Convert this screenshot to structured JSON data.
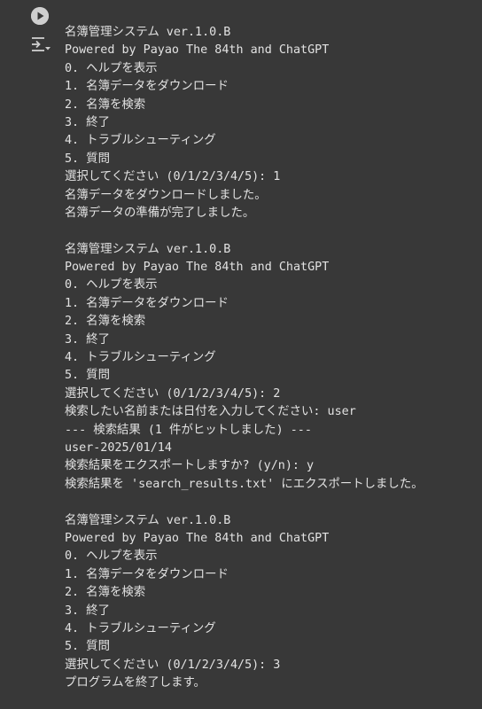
{
  "cell": {
    "run_icon": "play-circle-icon",
    "output_icon": "output-toggle-icon",
    "output_lines": [
      "名簿管理システム ver.1.0.B",
      "Powered by Payao The 84th and ChatGPT",
      "0. ヘルプを表示",
      "1. 名簿データをダウンロード",
      "2. 名簿を検索",
      "3. 終了",
      "4. トラブルシューティング",
      "5. 質問",
      "選択してください (0/1/2/3/4/5): 1",
      "名簿データをダウンロードしました。",
      "名簿データの準備が完了しました。",
      "",
      "名簿管理システム ver.1.0.B",
      "Powered by Payao The 84th and ChatGPT",
      "0. ヘルプを表示",
      "1. 名簿データをダウンロード",
      "2. 名簿を検索",
      "3. 終了",
      "4. トラブルシューティング",
      "5. 質問",
      "選択してください (0/1/2/3/4/5): 2",
      "検索したい名前または日付を入力してください: user",
      "--- 検索結果 (1 件がヒットしました) ---",
      "user-2025/01/14",
      "検索結果をエクスポートしますか? (y/n): y",
      "検索結果を 'search_results.txt' にエクスポートしました。",
      "",
      "名簿管理システム ver.1.0.B",
      "Powered by Payao The 84th and ChatGPT",
      "0. ヘルプを表示",
      "1. 名簿データをダウンロード",
      "2. 名簿を検索",
      "3. 終了",
      "4. トラブルシューティング",
      "5. 質問",
      "選択してください (0/1/2/3/4/5): 3",
      "プログラムを終了します。"
    ]
  }
}
